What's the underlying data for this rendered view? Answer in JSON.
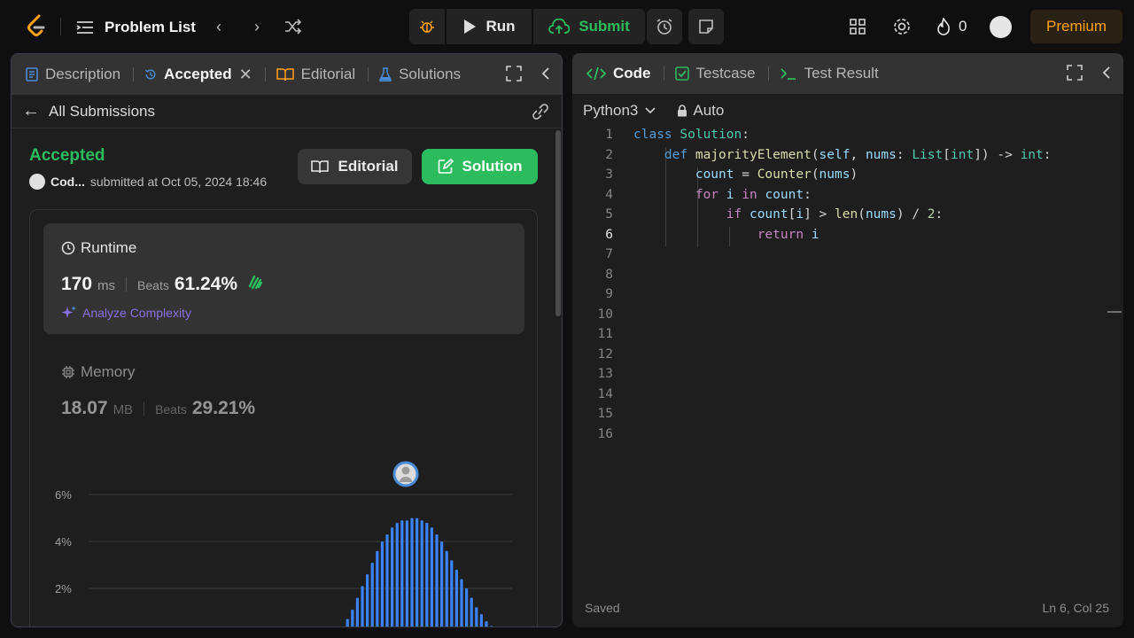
{
  "topbar": {
    "problem_list_label": "Problem List",
    "run_label": "Run",
    "submit_label": "Submit",
    "streak_count": "0",
    "premium_label": "Premium"
  },
  "left_tabs": {
    "description": "Description",
    "accepted": "Accepted",
    "editorial": "Editorial",
    "solutions": "Solutions"
  },
  "submission": {
    "back_label": "All Submissions",
    "status": "Accepted",
    "user": "Cod...",
    "submitted_at": "submitted at Oct 05, 2024 18:46",
    "editorial_button": "Editorial",
    "solution_button": "Solution",
    "runtime": {
      "label": "Runtime",
      "value": "170",
      "unit": "ms",
      "beats_label": "Beats",
      "beats_pct": "61.24%",
      "analyze_label": "Analyze Complexity"
    },
    "memory": {
      "label": "Memory",
      "value": "18.07",
      "unit": "MB",
      "beats_label": "Beats",
      "beats_pct": "29.21%"
    }
  },
  "chart_data": {
    "type": "bar",
    "ytick_labels": [
      "6%",
      "4%",
      "2%"
    ],
    "ylim": [
      0,
      6.8
    ],
    "grid": true,
    "values": [
      0.3,
      0.7,
      1.1,
      1.6,
      2.1,
      2.6,
      3.1,
      3.6,
      4.0,
      4.3,
      4.6,
      4.8,
      4.9,
      4.9,
      5.0,
      5.0,
      4.9,
      4.8,
      4.6,
      4.3,
      4.0,
      3.6,
      3.2,
      2.8,
      2.4,
      2.0,
      1.6,
      1.2,
      0.9,
      0.6,
      0.4,
      0.2
    ],
    "highlight_index": 15,
    "bar_color": "#3b82f6"
  },
  "right_tabs": {
    "code": "Code",
    "testcase": "Testcase",
    "test_result": "Test Result"
  },
  "editor": {
    "language": "Python3",
    "mode": "Auto",
    "saved_label": "Saved",
    "cursor_position": "Ln 6, Col 25",
    "line_numbers": [
      "1",
      "2",
      "3",
      "4",
      "5",
      "6",
      "7",
      "8",
      "9",
      "10",
      "11",
      "12",
      "13",
      "14",
      "15",
      "16"
    ]
  }
}
